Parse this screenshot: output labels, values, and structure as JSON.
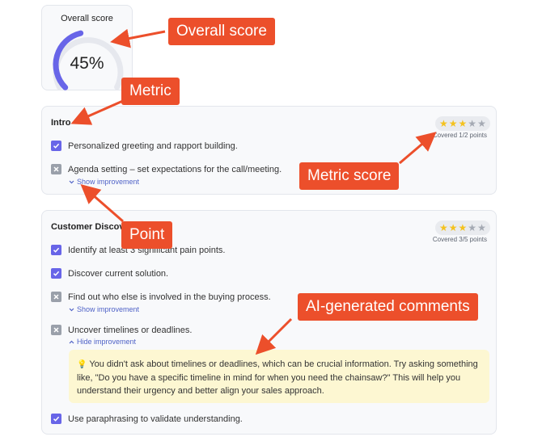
{
  "overall": {
    "title": "Overall score",
    "value": "45%",
    "progress": 0.45
  },
  "sections": [
    {
      "title": "Intro",
      "stars": {
        "on": 3,
        "total": 5
      },
      "covered": "Covered 1/2 points",
      "points": [
        {
          "text": "Personalized greeting and rapport building.",
          "checked": true
        },
        {
          "text": "Agenda setting – set expectations for the call/meeting.",
          "checked": false,
          "toggle": "Show improvement"
        }
      ]
    },
    {
      "title": "Customer Discove",
      "stars": {
        "on": 3,
        "total": 5
      },
      "covered": "Covered 3/5 points",
      "points": [
        {
          "text": "Identify at least 3 significant pain points.",
          "checked": true
        },
        {
          "text": "Discover current solution.",
          "checked": true
        },
        {
          "text": "Find out who else is involved in the buying process.",
          "checked": false,
          "toggle": "Show improvement"
        },
        {
          "text": "Uncover timelines or deadlines.",
          "checked": false,
          "toggle": "Hide improvement"
        },
        {
          "text": "Use paraphrasing to validate understanding.",
          "checked": true
        }
      ],
      "comment": {
        "line1": "You didn't ask about timelines or deadlines, which can be crucial information. Try asking something",
        "line2": "like, \"Do you have a specific timeline in mind for when you need the chainsaw?\" This will help you",
        "line3": "understand their urgency and better align your sales approach."
      }
    }
  ],
  "annotations": {
    "overall": "Overall  score",
    "metric": "Metric",
    "metric_score": "Metric score",
    "point": "Point",
    "ai": "AI-generated comments"
  },
  "colors": {
    "accent": "#6865e8",
    "annotation": "#ec4f2b",
    "star": "#f4c21f",
    "comment_bg": "#fdf7d2"
  },
  "icons": {
    "checked": "check-icon",
    "unchecked": "x-icon",
    "toggle": "chevron-icon",
    "tip": "lightbulb-icon"
  }
}
